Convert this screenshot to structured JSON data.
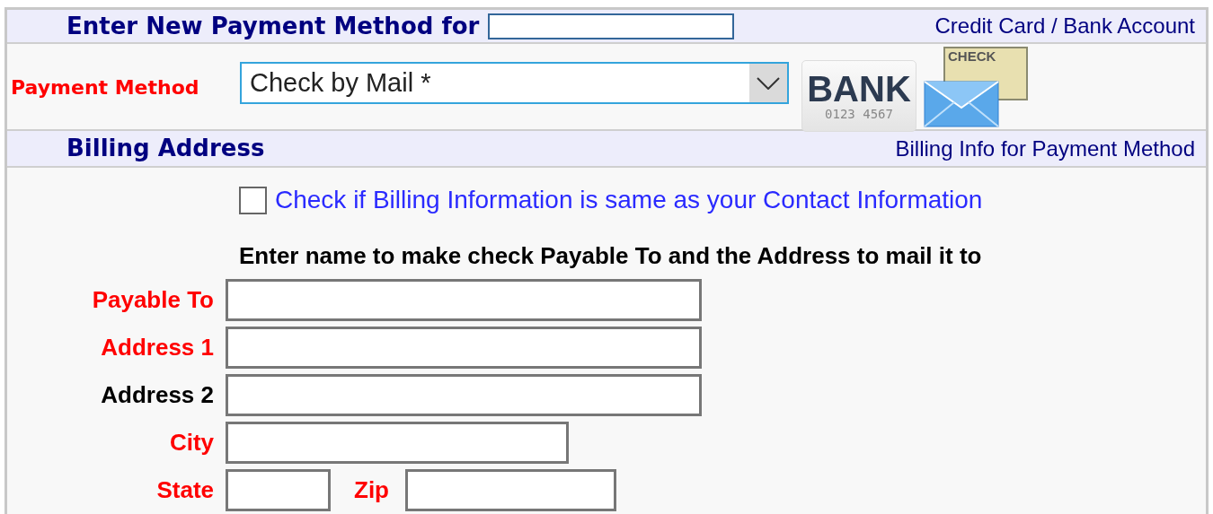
{
  "header": {
    "title": "Enter New Payment Method for",
    "note": "Credit Card / Bank Account"
  },
  "payment_method": {
    "label": "Payment Method",
    "required": true,
    "value": "Check by Mail *"
  },
  "icons": {
    "bank_label": "BANK",
    "bank_number": "0123 4567",
    "check_label": "CHECK"
  },
  "billing_header": {
    "title": "Billing Address",
    "note": "Billing Info for Payment Method"
  },
  "same_as_contact": {
    "label": "Check if Billing Information is same as your Contact Information",
    "checked": false
  },
  "instructions": "Enter name to make check Payable To and the Address to mail it to",
  "fields": [
    {
      "label": "Payable To",
      "required": true
    },
    {
      "label": "Address 1",
      "required": true
    },
    {
      "label": "Address 2",
      "required": false
    },
    {
      "label": "City",
      "required": true
    }
  ],
  "state_zip": [
    {
      "label": "State",
      "required": true
    },
    {
      "label": "Zip",
      "required": true
    }
  ]
}
